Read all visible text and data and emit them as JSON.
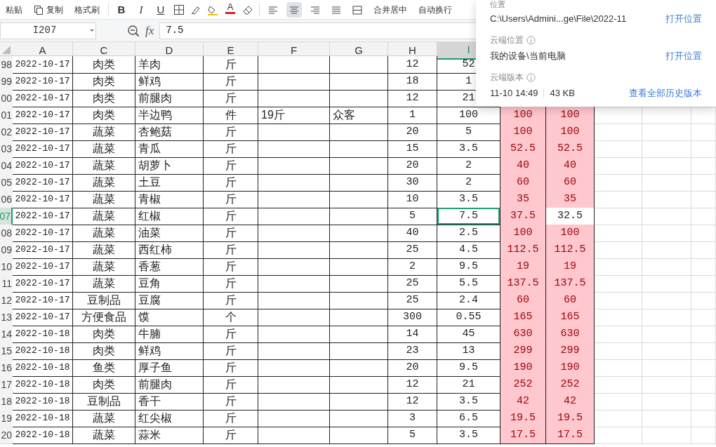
{
  "toolbar": {
    "paste": "粘贴",
    "copy": "复制",
    "format_painter": "格式刷",
    "font_styles": [
      "B",
      "I",
      "U"
    ],
    "font_color": "A",
    "alignment": [
      {
        "selected": false
      },
      {
        "selected": true
      },
      {
        "selected": false
      },
      {
        "selected": false
      },
      {
        "selected": false
      }
    ],
    "merge_center": "合并居中",
    "wrap_text": "自动换行"
  },
  "formula_bar": {
    "name_box": "I207",
    "fx": "fx",
    "value": "7.5"
  },
  "columns": [
    {
      "header": "A",
      "selected": false
    },
    {
      "header": "C",
      "selected": false
    },
    {
      "header": "D",
      "selected": false
    },
    {
      "header": "E",
      "selected": false
    },
    {
      "header": "F",
      "selected": false
    },
    {
      "header": "G",
      "selected": false
    },
    {
      "header": "H",
      "selected": false
    },
    {
      "header": "I",
      "selected": true
    }
  ],
  "rows": [
    {
      "number": "98",
      "selected": false,
      "A": "2022-10-17",
      "C": "肉类",
      "D": "羊肉",
      "E": "斤",
      "H": "12",
      "I": "52"
    },
    {
      "number": "99",
      "selected": false,
      "A": "2022-10-17",
      "C": "肉类",
      "D": "鲜鸡",
      "E": "斤",
      "H": "18",
      "I": "1"
    },
    {
      "number": "00",
      "selected": false,
      "A": "2022-10-17",
      "C": "肉类",
      "D": "前腿肉",
      "E": "斤",
      "H": "12",
      "I": "21"
    },
    {
      "number": "01",
      "selected": false,
      "A": "2022-10-17",
      "C": "肉类",
      "D": "半边鸭",
      "E": "件",
      "F": "19斤",
      "G": "众客",
      "H": "1",
      "I": "100",
      "totals": [
        {
          "text": "100",
          "highlighted": true
        },
        {
          "text": "100",
          "highlighted": true
        }
      ]
    },
    {
      "number": "02",
      "selected": false,
      "A": "2022-10-17",
      "C": "蔬菜",
      "D": "杏鲍菇",
      "E": "斤",
      "H": "20",
      "I": "5",
      "totals": [
        {
          "text": "100",
          "highlighted": true
        },
        {
          "text": "100",
          "highlighted": true
        }
      ]
    },
    {
      "number": "03",
      "selected": false,
      "A": "2022-10-17",
      "C": "蔬菜",
      "D": "青瓜",
      "E": "斤",
      "H": "15",
      "I": "3.5",
      "totals": [
        {
          "text": "52.5",
          "highlighted": true
        },
        {
          "text": "52.5",
          "highlighted": true
        }
      ]
    },
    {
      "number": "04",
      "selected": false,
      "A": "2022-10-17",
      "C": "蔬菜",
      "D": "胡萝卜",
      "E": "斤",
      "H": "20",
      "I": "2",
      "totals": [
        {
          "text": "40",
          "highlighted": true
        },
        {
          "text": "40",
          "highlighted": true
        }
      ]
    },
    {
      "number": "05",
      "selected": false,
      "A": "2022-10-17",
      "C": "蔬菜",
      "D": "土豆",
      "E": "斤",
      "H": "30",
      "I": "2",
      "totals": [
        {
          "text": "60",
          "highlighted": true
        },
        {
          "text": "60",
          "highlighted": true
        }
      ]
    },
    {
      "number": "06",
      "selected": false,
      "A": "2022-10-17",
      "C": "蔬菜",
      "D": "青椒",
      "E": "斤",
      "H": "10",
      "I": "3.5",
      "totals": [
        {
          "text": "35",
          "highlighted": true
        },
        {
          "text": "35",
          "highlighted": true
        }
      ]
    },
    {
      "number": "07",
      "selected": true,
      "A": "2022-10-17",
      "C": "蔬菜",
      "D": "红椒",
      "E": "斤",
      "H": "5",
      "I": "7.5",
      "totals": [
        {
          "text": "37.5",
          "highlighted": true
        },
        {
          "text": "32.5",
          "highlighted": false
        }
      ]
    },
    {
      "number": "08",
      "selected": false,
      "A": "2022-10-17",
      "C": "蔬菜",
      "D": "油菜",
      "E": "斤",
      "H": "40",
      "I": "2.5",
      "totals": [
        {
          "text": "100",
          "highlighted": true
        },
        {
          "text": "100",
          "highlighted": true
        }
      ]
    },
    {
      "number": "09",
      "selected": false,
      "A": "2022-10-17",
      "C": "蔬菜",
      "D": "西红柿",
      "E": "斤",
      "H": "25",
      "I": "4.5",
      "totals": [
        {
          "text": "112.5",
          "highlighted": true
        },
        {
          "text": "112.5",
          "highlighted": true
        }
      ]
    },
    {
      "number": "10",
      "selected": false,
      "A": "2022-10-17",
      "C": "蔬菜",
      "D": "香葱",
      "E": "斤",
      "H": "2",
      "I": "9.5",
      "totals": [
        {
          "text": "19",
          "highlighted": true
        },
        {
          "text": "19",
          "highlighted": true
        }
      ]
    },
    {
      "number": "11",
      "selected": false,
      "A": "2022-10-17",
      "C": "蔬菜",
      "D": "豆角",
      "E": "斤",
      "H": "25",
      "I": "5.5",
      "totals": [
        {
          "text": "137.5",
          "highlighted": true
        },
        {
          "text": "137.5",
          "highlighted": true
        }
      ]
    },
    {
      "number": "12",
      "selected": false,
      "A": "2022-10-17",
      "C": "豆制品",
      "D": "豆腐",
      "E": "斤",
      "H": "25",
      "I": "2.4",
      "totals": [
        {
          "text": "60",
          "highlighted": true
        },
        {
          "text": "60",
          "highlighted": true
        }
      ]
    },
    {
      "number": "13",
      "selected": false,
      "A": "2022-10-17",
      "C": "方便食品",
      "D": "馍",
      "E": "个",
      "H": "300",
      "I": "0.55",
      "totals": [
        {
          "text": "165",
          "highlighted": true
        },
        {
          "text": "165",
          "highlighted": true
        }
      ]
    },
    {
      "number": "14",
      "selected": false,
      "A": "2022-10-18",
      "C": "肉类",
      "D": "牛腩",
      "E": "斤",
      "H": "14",
      "I": "45",
      "totals": [
        {
          "text": "630",
          "highlighted": true
        },
        {
          "text": "630",
          "highlighted": true
        }
      ]
    },
    {
      "number": "15",
      "selected": false,
      "A": "2022-10-18",
      "C": "肉类",
      "D": "鲜鸡",
      "E": "斤",
      "H": "23",
      "I": "13",
      "totals": [
        {
          "text": "299",
          "highlighted": true
        },
        {
          "text": "299",
          "highlighted": true
        }
      ]
    },
    {
      "number": "16",
      "selected": false,
      "A": "2022-10-18",
      "C": "鱼类",
      "D": "厚子鱼",
      "E": "斤",
      "H": "20",
      "I": "9.5",
      "totals": [
        {
          "text": "190",
          "highlighted": true
        },
        {
          "text": "190",
          "highlighted": true
        }
      ]
    },
    {
      "number": "17",
      "selected": false,
      "A": "2022-10-18",
      "C": "肉类",
      "D": "前腿肉",
      "E": "斤",
      "H": "12",
      "I": "21",
      "totals": [
        {
          "text": "252",
          "highlighted": true
        },
        {
          "text": "252",
          "highlighted": true
        }
      ]
    },
    {
      "number": "18",
      "selected": false,
      "A": "2022-10-18",
      "C": "豆制品",
      "D": "香干",
      "E": "斤",
      "H": "12",
      "I": "3.5",
      "totals": [
        {
          "text": "42",
          "highlighted": true
        },
        {
          "text": "42",
          "highlighted": true
        }
      ]
    },
    {
      "number": "19",
      "selected": false,
      "A": "2022-10-18",
      "C": "蔬菜",
      "D": "红尖椒",
      "E": "斤",
      "H": "3",
      "I": "6.5",
      "totals": [
        {
          "text": "19.5",
          "highlighted": true
        },
        {
          "text": "19.5",
          "highlighted": true
        }
      ]
    },
    {
      "number": "20",
      "selected": false,
      "A": "2022-10-18",
      "C": "蔬菜",
      "D": "蒜米",
      "E": "斤",
      "H": "5",
      "I": "3.5",
      "totals": [
        {
          "text": "17.5",
          "highlighted": true
        },
        {
          "text": "17.5",
          "highlighted": true
        }
      ]
    }
  ],
  "file_info": {
    "location_label": "位置",
    "path": "C:\\Users\\Admini...ge\\File\\2022-11",
    "open_location": "打开位置",
    "cloud_location_label": "云端位置",
    "cloud_location": "我的设备\\当前电脑",
    "cloud_open_location": "打开位置",
    "cloud_version_label": "云端版本",
    "version_time": "11-10 14:49",
    "version_size": "43 KB",
    "history_link": "查看全部历史版本"
  }
}
